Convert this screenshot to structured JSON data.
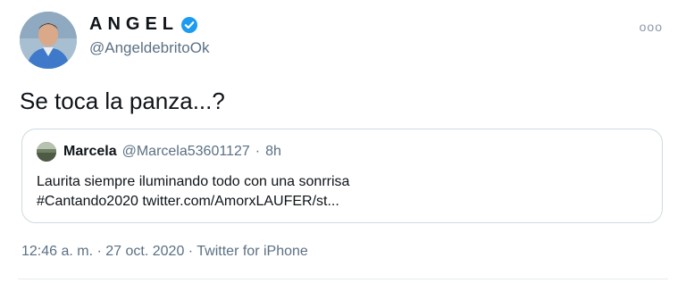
{
  "tweet": {
    "display_name": "ANGEL",
    "verified_icon": "verified-badge-icon",
    "handle": "@AngeldebritoOk",
    "more_icon": "more-options-icon",
    "more_glyph": "ooo",
    "text": "Se toca la panza...?",
    "timestamp": "12:46 a. m. · 27 oct. 2020",
    "separator": " · ",
    "source": "Twitter for iPhone"
  },
  "quote": {
    "name": "Marcela",
    "handle": "@Marcela53601127",
    "dot": "·",
    "time": "8h",
    "line1": "Laurita siempre iluminando todo con una sonrrisa",
    "line2": "#Cantando2020 twitter.com/AmorxLAUFER/st..."
  },
  "colors": {
    "verified": "#1d9bf0",
    "secondary_text": "#5b7083",
    "border": "#cfd9de"
  }
}
